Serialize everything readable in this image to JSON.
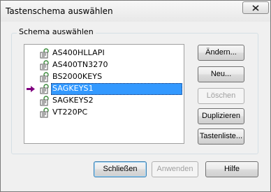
{
  "window": {
    "title": "Tastenschema auswählen"
  },
  "group": {
    "label": "Schema auswählen"
  },
  "schemes": [
    {
      "name": "AS400HLLAPI",
      "selected": false
    },
    {
      "name": "AS400TN3270",
      "selected": false
    },
    {
      "name": "BS2000KEYS",
      "selected": false
    },
    {
      "name": "SAGKEYS1",
      "selected": true
    },
    {
      "name": "SAGKEYS2",
      "selected": false
    },
    {
      "name": "VT220PC",
      "selected": false
    }
  ],
  "side_buttons": {
    "aendern": "Ändern...",
    "neu": "Neu...",
    "loeschen": "Löschen",
    "duplizieren": "Duplizieren",
    "tastenliste": "Tastenliste..."
  },
  "bottom_buttons": {
    "schliessen": "Schließen",
    "anwenden": "Anwenden",
    "hilfe": "Hilfe"
  },
  "colors": {
    "selection": "#3399ff",
    "marker_arrow": "#800080",
    "key_icon": "#3a8a3a"
  }
}
